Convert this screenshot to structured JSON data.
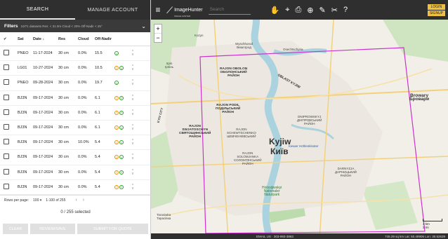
{
  "tabs": {
    "search": "SEARCH",
    "manage": "MANAGE ACCOUNT"
  },
  "filters": {
    "label": "Filters",
    "summary": "10/71 datasets  Res: < 31.0m  Cloud < 20%  Off-Nadir < 25°"
  },
  "table": {
    "headers": {
      "sat": "Sat",
      "date": "Date ↓",
      "res": "Res",
      "cloud": "Cloud",
      "offnadir": "Off-Nadir"
    },
    "rows": [
      {
        "sat": "PNEO",
        "date": "11-17-2024",
        "res": "30 cm",
        "cloud": "0.0%",
        "off": "15.5",
        "icons": [
          "green"
        ]
      },
      {
        "sat": "LG01",
        "date": "10-27-2024",
        "res": "30 cm",
        "cloud": "0.0%",
        "off": "10.5",
        "icons": [
          "orange",
          "green"
        ]
      },
      {
        "sat": "PNEO",
        "date": "09-28-2024",
        "res": "30 cm",
        "cloud": "0.0%",
        "off": "19.7",
        "icons": [
          "green"
        ]
      },
      {
        "sat": "BJ3N",
        "date": "09-17-2024",
        "res": "30 cm",
        "cloud": "0.0%",
        "off": "6.1",
        "icons": [
          "orange",
          "green"
        ]
      },
      {
        "sat": "BJ3N",
        "date": "09-17-2024",
        "res": "30 cm",
        "cloud": "0.0%",
        "off": "6.1",
        "icons": [
          "orange",
          "green"
        ]
      },
      {
        "sat": "BJ3N",
        "date": "09-17-2024",
        "res": "30 cm",
        "cloud": "0.0%",
        "off": "6.1",
        "icons": [
          "orange",
          "green"
        ]
      },
      {
        "sat": "BJ3N",
        "date": "09-17-2024",
        "res": "30 cm",
        "cloud": "10.0%",
        "off": "5.4",
        "icons": [
          "orange",
          "green"
        ]
      },
      {
        "sat": "BJ3N",
        "date": "09-17-2024",
        "res": "30 cm",
        "cloud": "0.0%",
        "off": "5.4",
        "icons": [
          "orange",
          "green"
        ]
      },
      {
        "sat": "BJ3N",
        "date": "09-17-2024",
        "res": "30 cm",
        "cloud": "0.0%",
        "off": "5.4",
        "icons": [
          "orange",
          "green"
        ]
      },
      {
        "sat": "BJ3N",
        "date": "09-17-2024",
        "res": "30 cm",
        "cloud": "0.0%",
        "off": "5.4",
        "icons": [
          "orange",
          "green"
        ]
      }
    ]
  },
  "pagination": {
    "rows_label": "Rows per page:",
    "rows_value": "100",
    "range": "1-100 of 255"
  },
  "selection": "0 / 255 selected",
  "actions": {
    "clear": "CLEAR",
    "review": "REVIEW/SAVE",
    "quote": "SUBMIT FOR QUOTE"
  },
  "topbar": {
    "logo": "ImageHunter",
    "logo_sub": "IMAGE HUNTER",
    "search_placeholder": "Search",
    "login": "LOGIN",
    "signup": "SIGNUP"
  },
  "map": {
    "city_latin": "Kyjiw",
    "city_cyr": "Київ",
    "labels": {
      "obolon": "RAJON OBOLON\nОБОЛОНСЬКИЙ\nРАЙОН",
      "podil": "RAJON PODIL\nПОДІЛЬСЬКИЙ\nРАЙОН",
      "svyat": "RAJON\nSWJATOSCHYN\nСВЯТОШИНСЬКИЙ\nРАЙОН",
      "shev": "RAJON\nSCHEWTSCHENKO\nШЕВЧЕНКІВСЬКИЙ",
      "dnipro": "DNIPROWSKYJ\nДНІПРОВСЬКИЙ\nРАЙОН",
      "solom": "RAJON\nSOLOMJANKA\nСОЛОМ'ЯНСЬКИЙ\nРАЙОН",
      "holos": "Holosijiwskyi\nNationaler\nNaturpark",
      "darnytsia": "DARNYZJA\nДАРНИЦЬКИЙ\nРАЙОН",
      "brovary": "Browary\nБровари",
      "vyshhorod": "Wyschhorod\nВишгород",
      "osechtschyna": "Osechtschyna",
      "irpin": "Irpin\nІрпінь",
      "kozyn": "Kozyn",
      "vitachiv": "Tarasiwka\nТарасівка",
      "kyiv_city": "KYIV CITY",
      "kiewer_h": "Kiewer Höhlenkloster",
      "oblast_n": "OBLAST KYJIW"
    },
    "zoom_in": "+",
    "zoom_out": "−",
    "scale": [
      "3 km",
      "3 mi"
    ]
  },
  "footer": {
    "email": "EMAIL US",
    "phone": "303-993-3863",
    "zoom": "745.29 sq km",
    "lat": "Lat: 50.49906",
    "lon": "Lon: 30.52639"
  },
  "colors": {
    "dark": "#2f2f2f",
    "accent": "#f0a030",
    "aoi": "#cc33cc",
    "river": "#aad3df",
    "green": "#2e9e2e",
    "orange": "#f08c00"
  }
}
